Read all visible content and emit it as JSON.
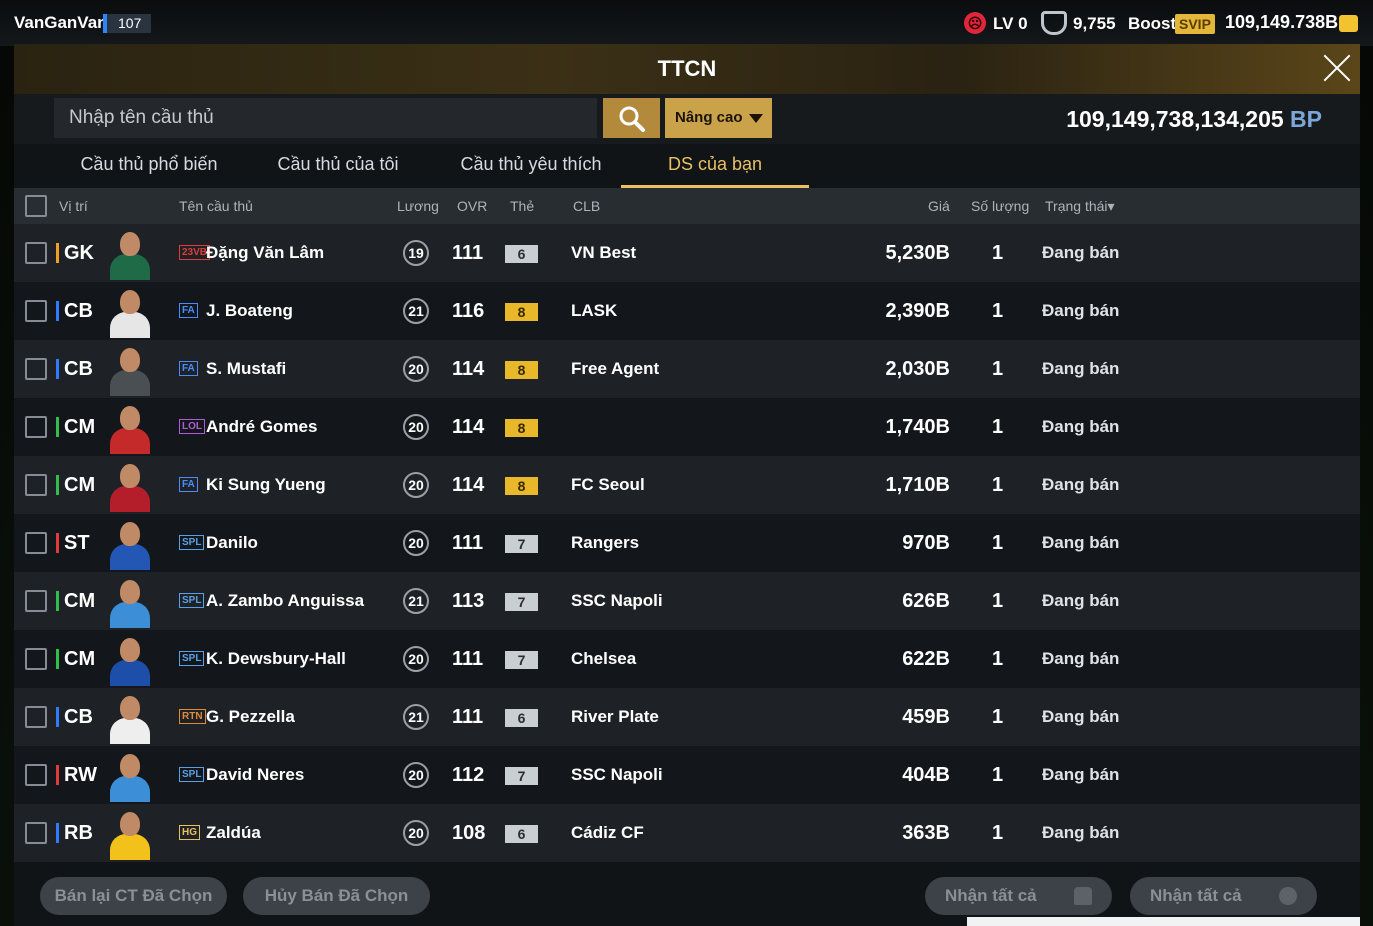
{
  "topbar": {
    "username": "VanGanVan",
    "level": "107",
    "lv_text": "LV 0",
    "shield_value": "9,755",
    "boost_label": "Boost",
    "svip_label": "SVIP",
    "bp_balance": "109,149.738B"
  },
  "panel": {
    "title": "TTCN",
    "search": {
      "placeholder": "Nhập tên cầu thủ",
      "advanced_label": "Nâng cao"
    },
    "bp_total": "109,149,738,134,205",
    "bp_unit": "BP",
    "tabs": [
      {
        "label": "Cầu thủ phổ biến"
      },
      {
        "label": "Cầu thủ của tôi"
      },
      {
        "label": "Cầu thủ yêu thích"
      },
      {
        "label": "DS của bạn"
      }
    ],
    "active_tab": "DS của bạn",
    "columns": {
      "position": "Vị trí",
      "name": "Tên cầu thủ",
      "salary": "Lương",
      "ovr": "OVR",
      "card": "Thẻ",
      "club": "CLB",
      "price": "Giá",
      "quantity": "Số lượng",
      "status": "Trạng thái▾"
    },
    "rows": [
      {
        "pos": "GK",
        "pos_color": "#f0a020",
        "season": "23VB",
        "season_color": "#e03a3a",
        "name": "Đặng Văn Lâm",
        "salary": "19",
        "ovr": "111",
        "grade": "6",
        "grade_color": "#c9ced3",
        "club": "VN Best",
        "price": "5,230B",
        "qty": "1",
        "status": "Đang bán",
        "kit": "#1f6b48"
      },
      {
        "pos": "CB",
        "pos_color": "#2e7bff",
        "season": "FA",
        "season_color": "#4a8cff",
        "name": "J. Boateng",
        "salary": "21",
        "ovr": "116",
        "grade": "8",
        "grade_color": "#e8b72a",
        "club": "LASK",
        "price": "2,390B",
        "qty": "1",
        "status": "Đang bán",
        "kit": "#e6e6e6"
      },
      {
        "pos": "CB",
        "pos_color": "#2e7bff",
        "season": "FA",
        "season_color": "#4a8cff",
        "name": "S. Mustafi",
        "salary": "20",
        "ovr": "114",
        "grade": "8",
        "grade_color": "#e8b72a",
        "club": "Free Agent",
        "price": "2,030B",
        "qty": "1",
        "status": "Đang bán",
        "kit": "#4a4f54"
      },
      {
        "pos": "CM",
        "pos_color": "#2fbf4a",
        "season": "LOL",
        "season_color": "#b05bd6",
        "name": "André Gomes",
        "salary": "20",
        "ovr": "114",
        "grade": "8",
        "grade_color": "#e8b72a",
        "club": "",
        "price": "1,740B",
        "qty": "1",
        "status": "Đang bán",
        "kit": "#c42a2a"
      },
      {
        "pos": "CM",
        "pos_color": "#2fbf4a",
        "season": "FA",
        "season_color": "#4a8cff",
        "name": "Ki Sung Yueng",
        "salary": "20",
        "ovr": "114",
        "grade": "8",
        "grade_color": "#e8b72a",
        "club": "FC Seoul",
        "price": "1,710B",
        "qty": "1",
        "status": "Đang bán",
        "kit": "#b31e2a"
      },
      {
        "pos": "ST",
        "pos_color": "#e03a3a",
        "season": "SPL",
        "season_color": "#5aa0e6",
        "name": "Danilo",
        "salary": "20",
        "ovr": "111",
        "grade": "7",
        "grade_color": "#c9ced3",
        "club": "Rangers",
        "price": "970B",
        "qty": "1",
        "status": "Đang bán",
        "kit": "#2457b5"
      },
      {
        "pos": "CM",
        "pos_color": "#2fbf4a",
        "season": "SPL",
        "season_color": "#5aa0e6",
        "name": "A. Zambo Anguissa",
        "salary": "21",
        "ovr": "113",
        "grade": "7",
        "grade_color": "#c9ced3",
        "club": "SSC Napoli",
        "price": "626B",
        "qty": "1",
        "status": "Đang bán",
        "kit": "#3c8fd6"
      },
      {
        "pos": "CM",
        "pos_color": "#2fbf4a",
        "season": "SPL",
        "season_color": "#5aa0e6",
        "name": "K. Dewsbury-Hall",
        "salary": "20",
        "ovr": "111",
        "grade": "7",
        "grade_color": "#c9ced3",
        "club": "Chelsea",
        "price": "622B",
        "qty": "1",
        "status": "Đang bán",
        "kit": "#1d4fa8"
      },
      {
        "pos": "CB",
        "pos_color": "#2e7bff",
        "season": "RTN",
        "season_color": "#e08a3a",
        "name": "G. Pezzella",
        "salary": "21",
        "ovr": "111",
        "grade": "6",
        "grade_color": "#c9ced3",
        "club": "River Plate",
        "price": "459B",
        "qty": "1",
        "status": "Đang bán",
        "kit": "#eeeeee"
      },
      {
        "pos": "RW",
        "pos_color": "#e03a3a",
        "season": "SPL",
        "season_color": "#5aa0e6",
        "name": "David Neres",
        "salary": "20",
        "ovr": "112",
        "grade": "7",
        "grade_color": "#c9ced3",
        "club": "SSC Napoli",
        "price": "404B",
        "qty": "1",
        "status": "Đang bán",
        "kit": "#3c8fd6"
      },
      {
        "pos": "RB",
        "pos_color": "#2e7bff",
        "season": "HG",
        "season_color": "#e6c060",
        "name": "Zaldúa",
        "salary": "20",
        "ovr": "108",
        "grade": "6",
        "grade_color": "#c9ced3",
        "club": "Cádiz CF",
        "price": "363B",
        "qty": "1",
        "status": "Đang bán",
        "kit": "#f2c21a"
      }
    ],
    "buttons": {
      "resell": "Bán lại CT Đã Chọn",
      "cancel_sell": "Hủy Bán Đã Chọn",
      "claim_all_players": "Nhận tất cả",
      "claim_all_bp": "Nhận tất cả"
    }
  }
}
